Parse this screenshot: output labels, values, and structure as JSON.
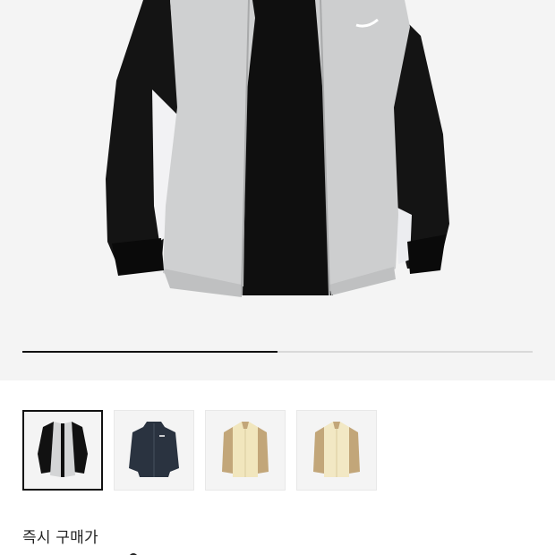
{
  "product": {
    "image_alt": "track-jacket-main-image",
    "gallery_progress": 0.5
  },
  "thumbnails": [
    {
      "name": "thumb-grey-black",
      "selected": true
    },
    {
      "name": "thumb-navy",
      "selected": false
    },
    {
      "name": "thumb-cream-beige-1",
      "selected": false
    },
    {
      "name": "thumb-cream-beige-2",
      "selected": false
    }
  ],
  "price": {
    "label": "즉시 구매가"
  },
  "colors": {
    "accent": "#111111",
    "background": "#f4f4f4"
  }
}
